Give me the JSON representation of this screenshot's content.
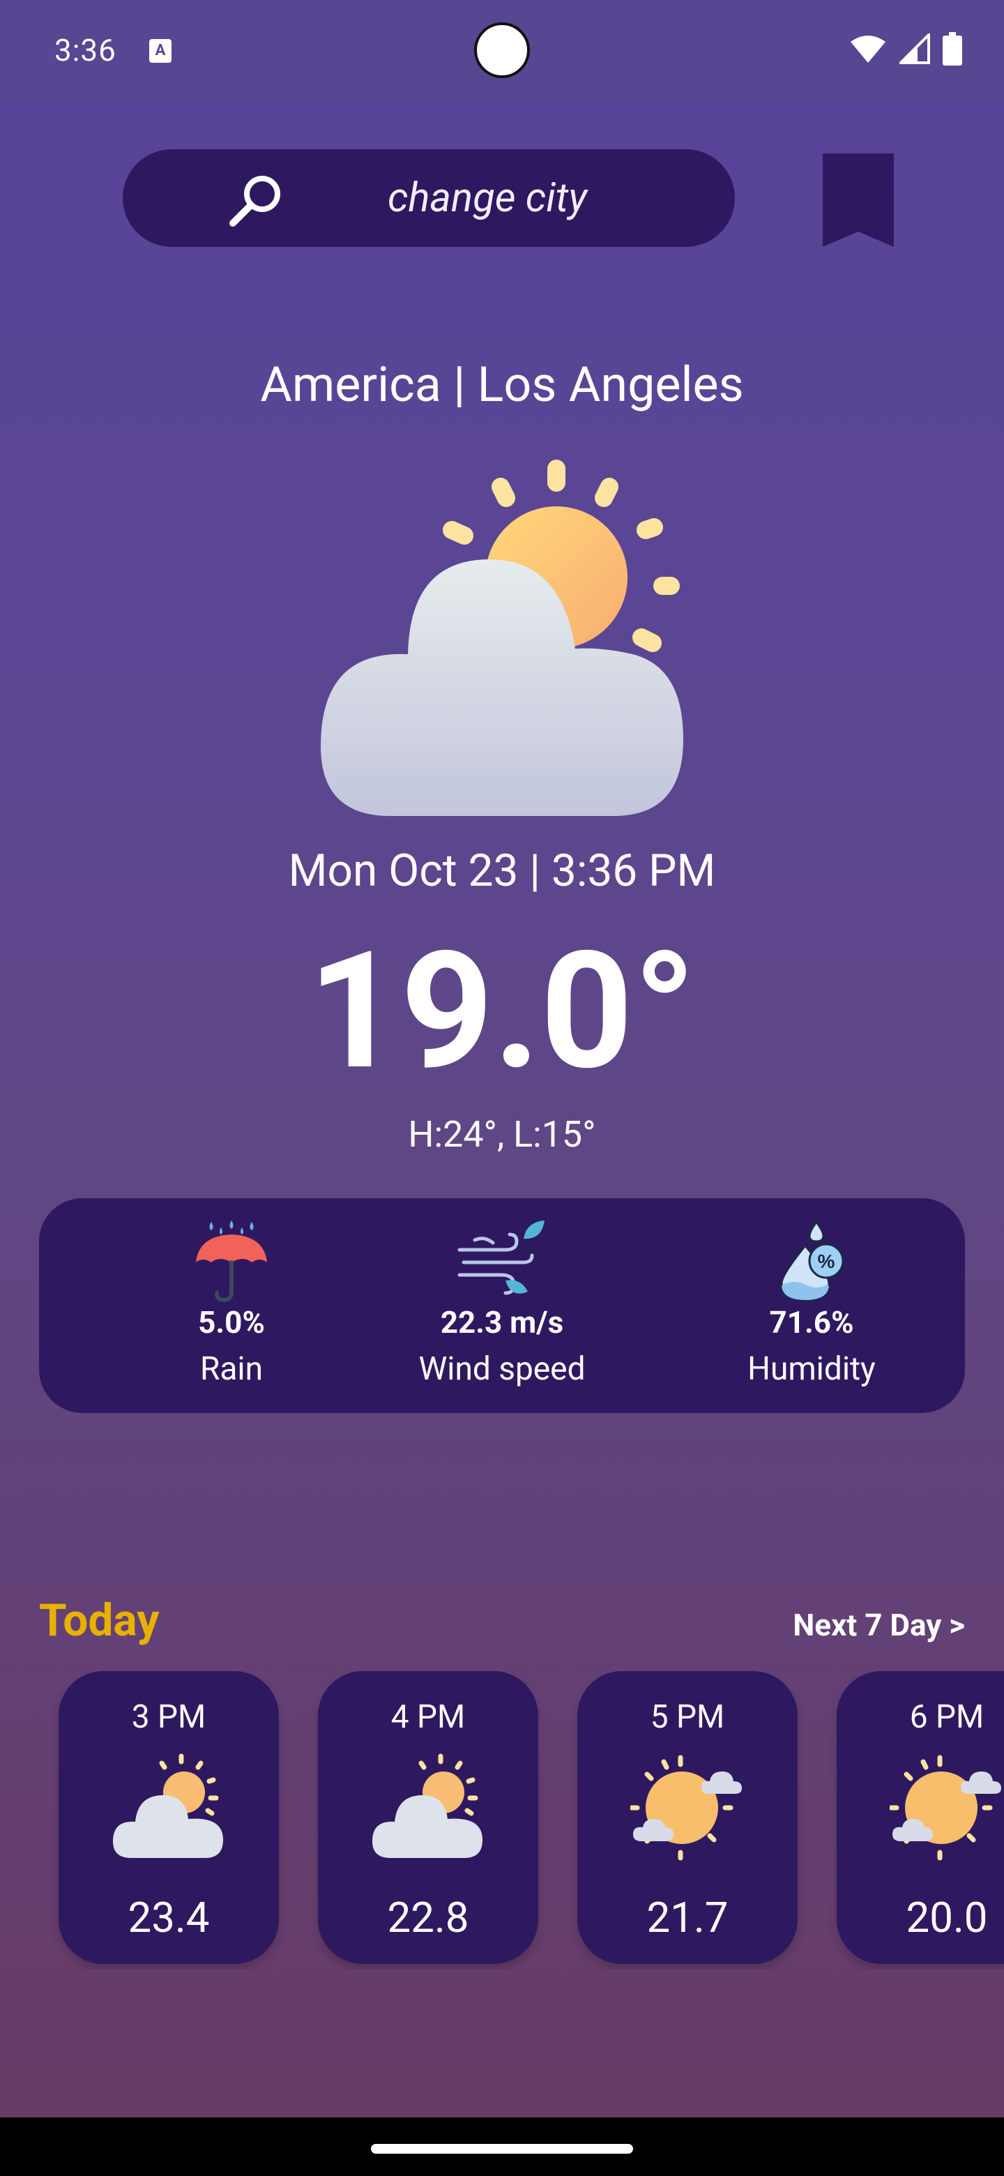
{
  "status_bar": {
    "time": "3:36",
    "notification_icon": "a-icon"
  },
  "search": {
    "placeholder": "change city"
  },
  "location": {
    "label": "America | Los Angeles"
  },
  "current": {
    "condition_icon": "partly-cloudy-icon",
    "datetime": "Mon Oct 23 | 3:36 PM",
    "temperature": "19.0°",
    "high_low": "H:24°, L:15°"
  },
  "stats": [
    {
      "icon": "umbrella-rain-icon",
      "value": "5.0%",
      "label": "Rain"
    },
    {
      "icon": "wind-icon",
      "value": "22.3 m/s",
      "label": "Wind speed"
    },
    {
      "icon": "humidity-drop-icon",
      "value": "71.6%",
      "label": "Humidity"
    }
  ],
  "forecast": {
    "title": "Today",
    "next_link": "Next 7 Day >",
    "hours": [
      {
        "hour": "3 PM",
        "icon": "cloud-sun-icon",
        "temp": "23.4"
      },
      {
        "hour": "4 PM",
        "icon": "cloud-sun-icon",
        "temp": "22.8"
      },
      {
        "hour": "5 PM",
        "icon": "sun-clouds-icon",
        "temp": "21.7"
      },
      {
        "hour": "6 PM",
        "icon": "sun-clouds-icon",
        "temp": "20.0"
      }
    ]
  },
  "colors": {
    "accent": "#eab000",
    "panel": "#2e1960",
    "background": "#5b4693"
  }
}
